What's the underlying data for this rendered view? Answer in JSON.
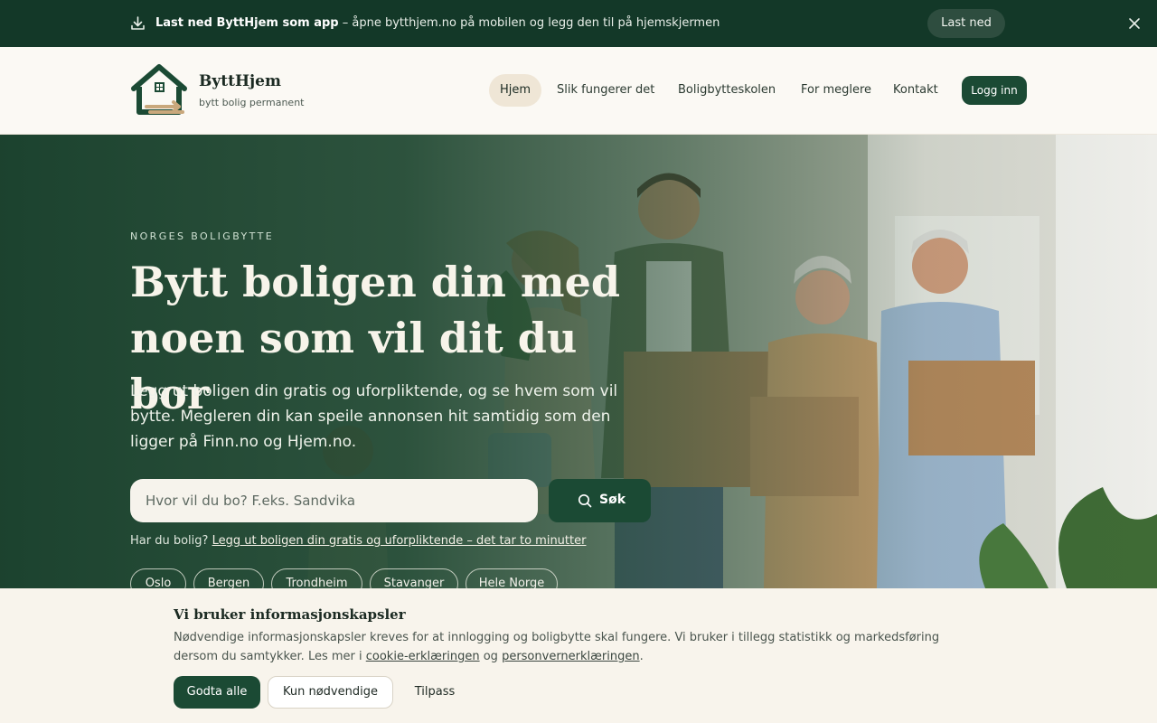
{
  "topbar": {
    "title": "Last ned ByttHjem som app",
    "message": " – åpne bytthjem.no på mobilen og legg den til på hjemskjermen",
    "button": "Last ned"
  },
  "header": {
    "brand_name": "ByttHjem",
    "brand_tagline": "bytt bolig permanent",
    "nav": [
      "Hjem",
      "Slik fungerer det",
      "Boligbytteskolen",
      "For meglere",
      "Kontakt"
    ],
    "login": "Logg inn"
  },
  "hero": {
    "eyebrow": "NORGES BOLIGBYTTE",
    "title": "Bytt boligen din med noen som vil dit du bor",
    "subtitle": "Legg ut boligen din gratis og uforpliktende, og se hvem som vil bytte. Megleren din kan speile annonsen hit samtidig som den ligger på Finn.no og Hjem.no.",
    "search_placeholder": "Hvor vil du bo? F.eks. Sandvika",
    "search_button": "Søk",
    "own_home_prefix": "Har du bolig?",
    "own_home_link": "Legg ut boligen din gratis og uforpliktende – det tar to minutter",
    "chips": [
      "Oslo",
      "Bergen",
      "Trondheim",
      "Stavanger",
      "Hele Norge"
    ]
  },
  "cookie": {
    "title": "Vi bruker informasjonskapsler",
    "text": "Nødvendige informasjonskapsler kreves for at innlogging og boligbytte skal fungere. Vi bruker i tillegg statistikk og markedsføring dersom du samtykker. Les mer i ",
    "link1": "cookie-erklæringen",
    "and": " og ",
    "link2": "personvernerklæringen",
    "end": ".",
    "accept": "Godta alle",
    "necessary": "Kun nødvendige",
    "customize": "Tilpass"
  },
  "colors": {
    "primary": "#1b4a34",
    "topbar": "#133828",
    "accent_tan": "#efe6d6"
  }
}
